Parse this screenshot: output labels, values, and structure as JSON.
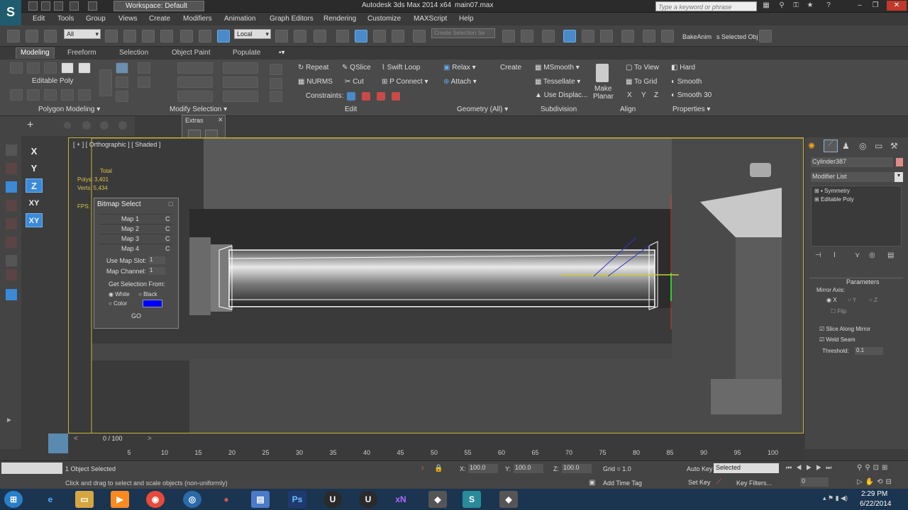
{
  "titlebar": {
    "workspace": "Workspace: Default",
    "app_title": "Autodesk 3ds Max  2014 x64",
    "file_name": "main07.max",
    "search_placeholder": "Type a keyword or phrase"
  },
  "menu": {
    "items": [
      "Edit",
      "Tools",
      "Group",
      "Views",
      "Create",
      "Modifiers",
      "Animation",
      "Graph Editors",
      "Rendering",
      "Customize",
      "MAXScript",
      "Help"
    ]
  },
  "toolbar": {
    "selection_filter": "All",
    "ref_coord": "Local",
    "selection_set": "Create Selection Se",
    "bake_anim": "BakeAnim",
    "selected_obj": "s Selected Obj"
  },
  "ribbon": {
    "tabs": [
      "Modeling",
      "Freeform",
      "Selection",
      "Object Paint",
      "Populate"
    ],
    "active_tab": "Modeling",
    "editable_poly": "Editable Poly",
    "polygon_modeling": "Polygon Modeling",
    "modify_selection": "Modify Selection",
    "edit": {
      "repeat": "Repeat",
      "qslice": "QSlice",
      "swift_loop": "Swift Loop",
      "nurms": "NURMS",
      "cut": "Cut",
      "p_connect": "P Connect",
      "constraints": "Constraints:",
      "title": "Edit"
    },
    "geometry": {
      "relax": "Relax",
      "create": "Create",
      "attach": "Attach",
      "title": "Geometry (All)"
    },
    "subdivision": {
      "msmooth": "MSmooth",
      "tessellate": "Tessellate",
      "use_displac": "Use Displac...",
      "title": "Subdivision"
    },
    "align": {
      "make": "Make",
      "planar": "Planar",
      "to_view": "To View",
      "to_grid": "To Grid",
      "x": "X",
      "y": "Y",
      "z": "Z",
      "title": "Align"
    },
    "properties": {
      "hard": "Hard",
      "smooth": "Smooth",
      "smooth30": "Smooth 30",
      "title": "Properties"
    }
  },
  "axis": [
    "X",
    "Y",
    "Z",
    "XY",
    "XY"
  ],
  "extras": {
    "title": "Extras"
  },
  "viewport": {
    "label": "[ + ] [ Orthographic ] [ Shaded ]",
    "stats": [
      "Total",
      "Polys:   3,401",
      "Verts:   5,434",
      "FPS:"
    ]
  },
  "bitmap_select": {
    "title": "Bitmap Select",
    "maps": [
      "Map 1",
      "Map 2",
      "Map 3",
      "Map 4"
    ],
    "map_btn": "C",
    "use_map_slot": "Use Map Slot:",
    "map_channel": "Map Channel:",
    "slot_value": "1",
    "channel_value": "1",
    "get_selection": "Get Selection From:",
    "white": "White",
    "black": "Black",
    "color": "Color",
    "swatch_color": "#0000ff",
    "go": "GO"
  },
  "command_panel": {
    "object_name": "Cylinder387",
    "modifier_list": "Modifier List",
    "stack": [
      "Symmetry",
      "Editable Poly"
    ],
    "parameters": "Parameters",
    "mirror_axis": "Mirror Axis:",
    "axes": [
      "X",
      "Y",
      "Z"
    ],
    "flip": "Flip",
    "slice_along_mirror": "Slice Along Mirror",
    "weld_seam": "Weld Seam",
    "threshold_label": "Threshold:",
    "threshold_value": "0.1"
  },
  "timeline": {
    "frame": "0 / 100",
    "ticks": [
      "5",
      "10",
      "15",
      "20",
      "25",
      "30",
      "35",
      "40",
      "45",
      "50",
      "55",
      "60",
      "65",
      "70",
      "75",
      "80",
      "85",
      "90",
      "95",
      "100"
    ]
  },
  "status": {
    "selected": "1 Object Selected",
    "prompt": "Click and drag to select and scale objects (non-uniformly)",
    "x_label": "X:",
    "x_value": "100.0",
    "y_label": "Y:",
    "y_value": "100.0",
    "z_label": "Z:",
    "z_value": "100.0",
    "grid": "Grid = 1.0",
    "add_time_tag": "Add Time Tag",
    "auto_key": "Auto Key",
    "selected_dd": "Selected",
    "set_key": "Set Key",
    "key_filters": "Key Filters...",
    "frame_field": "0"
  },
  "taskbar": {
    "time": "2:29 PM",
    "date": "6/22/2014"
  }
}
